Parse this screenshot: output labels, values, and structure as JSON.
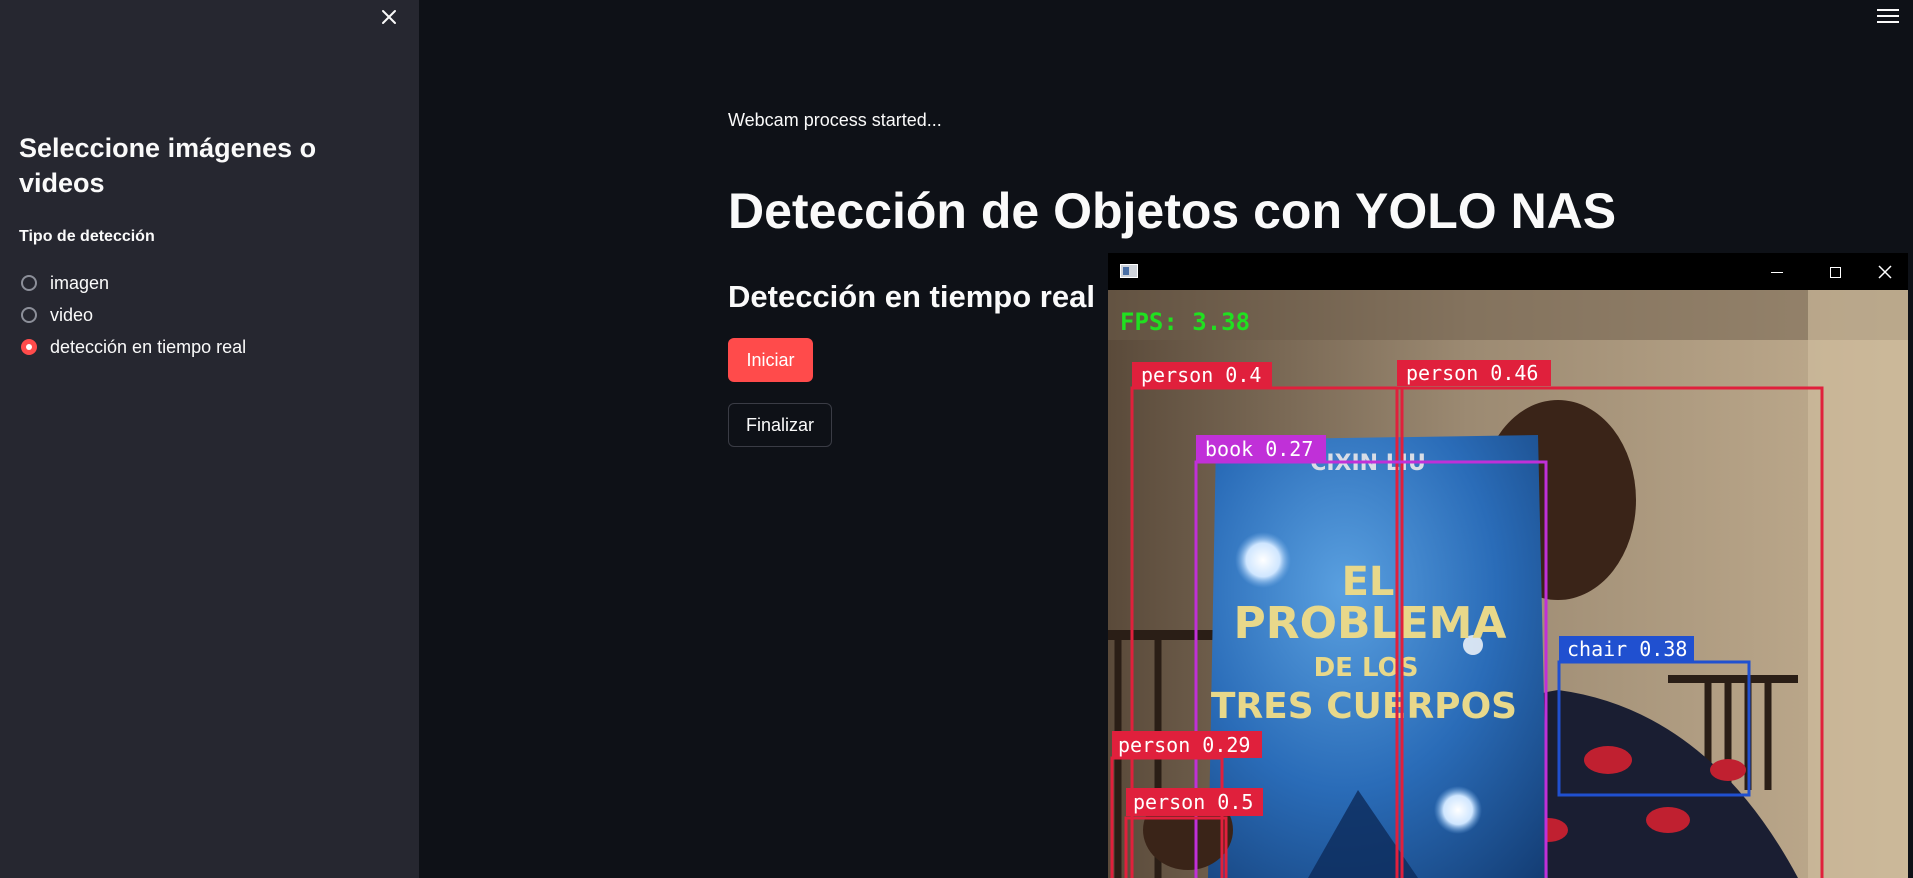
{
  "sidebar": {
    "close_icon": "close-icon",
    "title": "Seleccione imágenes o videos",
    "radio_label": "Tipo de detección",
    "options": [
      {
        "label": "imagen",
        "selected": false
      },
      {
        "label": "video",
        "selected": false
      },
      {
        "label": "detección en tiempo real",
        "selected": true
      }
    ]
  },
  "main": {
    "menu_icon": "hamburger-menu-icon",
    "status": "Webcam process started...",
    "title": "Detección de Objetos con YOLO NAS",
    "subtitle": "Detección en tiempo real",
    "start_button": "Iniciar",
    "stop_button": "Finalizar",
    "accent_color": "#ff4b4b"
  },
  "video_window": {
    "fps_text": "FPS: 3.38",
    "book": {
      "author": "CIXIN LIU",
      "title_line1": "EL",
      "title_line2": "PROBLEMA",
      "title_line3": "DE LOS",
      "title_line4": "TRES CUERPOS"
    },
    "detections": [
      {
        "label": "person 0.4",
        "color": "#e0203c"
      },
      {
        "label": "person 0.46",
        "color": "#e0203c"
      },
      {
        "label": "book 0.27",
        "color": "#c030d8"
      },
      {
        "label": "chair 0.38",
        "color": "#2050d0"
      },
      {
        "label": "person 0.29",
        "color": "#e0203c"
      },
      {
        "label": "person 0.5",
        "color": "#e0203c"
      }
    ]
  }
}
